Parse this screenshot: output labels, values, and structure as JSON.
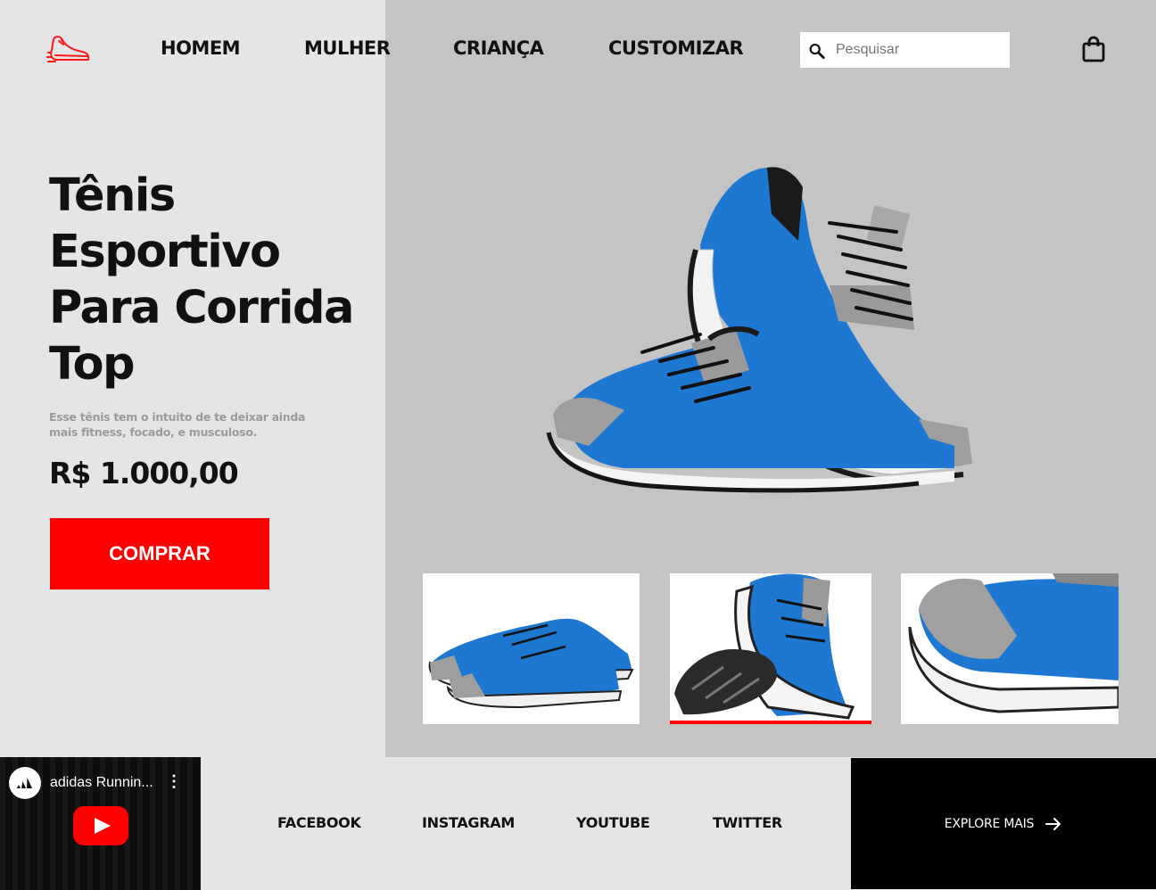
{
  "header": {
    "logo_icon": "running-shoe-icon",
    "nav": [
      {
        "label": "HOMEM"
      },
      {
        "label": "MULHER"
      },
      {
        "label": "CRIANÇA"
      },
      {
        "label": "CUSTOMIZAR"
      }
    ],
    "search": {
      "placeholder": "Pesquisar",
      "icon": "search-icon"
    },
    "cart_icon": "shopping-bag-icon"
  },
  "hero": {
    "title_lines": [
      "Tênis",
      "Esportivo",
      "Para Corrida",
      "Top"
    ],
    "description": "Esse tênis tem o intuito de te deixar ainda mais fitness, focado, e musculoso.",
    "price": "R$ 1.000,00",
    "buy_label": "COMPRAR"
  },
  "gallery": {
    "selected_index": 1,
    "thumbnails": [
      "shoe-side-view",
      "shoe-sole-view",
      "shoe-heel-closeup"
    ]
  },
  "footer": {
    "video": {
      "channel_title": "adidas Runnin...",
      "play_icon": "youtube-play-icon"
    },
    "social": [
      {
        "label": "FACEBOOK"
      },
      {
        "label": "INSTAGRAM"
      },
      {
        "label": "YOUTUBE"
      },
      {
        "label": "TWITTER"
      }
    ],
    "explore_label": "EXPLORE MAIS"
  },
  "colors": {
    "accent": "#ff0000",
    "left_bg": "#e5e5e5",
    "right_bg": "#c4c4c4",
    "shoe_blue": "#1e78d2"
  }
}
